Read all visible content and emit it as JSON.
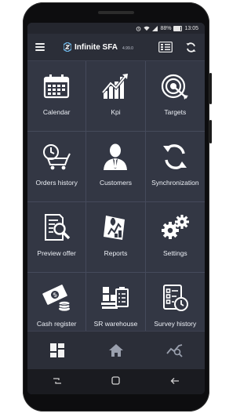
{
  "status_bar": {
    "battery_percent": "88%",
    "time": "13:05",
    "icons": [
      "alarm-icon",
      "wifi-icon",
      "signal-icon",
      "battery-icon"
    ]
  },
  "app_bar": {
    "brand_name": "Infinite SFA",
    "brand_version": "4.99.0",
    "left_icon": "hamburger-menu-icon",
    "right_icons": [
      "barcode-scanner-icon",
      "sync-icon"
    ]
  },
  "tiles": [
    {
      "label": "Calendar",
      "icon": "calendar-icon"
    },
    {
      "label": "Kpi",
      "icon": "kpi-chart-icon"
    },
    {
      "label": "Targets",
      "icon": "target-icon"
    },
    {
      "label": "Orders history",
      "icon": "cart-history-icon"
    },
    {
      "label": "Customers",
      "icon": "customer-icon"
    },
    {
      "label": "Synchronization",
      "icon": "sync-icon"
    },
    {
      "label": "Preview offer",
      "icon": "document-search-icon"
    },
    {
      "label": "Reports",
      "icon": "report-icon"
    },
    {
      "label": "Settings",
      "icon": "gears-icon"
    },
    {
      "label": "Cash register",
      "icon": "cash-icon"
    },
    {
      "label": "SR warehouse",
      "icon": "warehouse-icon"
    },
    {
      "label": "Survey history",
      "icon": "survey-history-icon"
    }
  ],
  "bottom_nav": [
    "dashboard-icon",
    "home-icon",
    "analytics-search-icon"
  ],
  "system_nav": [
    "recent-apps-icon",
    "home-square-icon",
    "back-icon"
  ],
  "colors": {
    "screen_bg": "#333744",
    "appbar_bg": "#2b2e38",
    "divider": "#454a5b",
    "icon": "#ffffff"
  }
}
